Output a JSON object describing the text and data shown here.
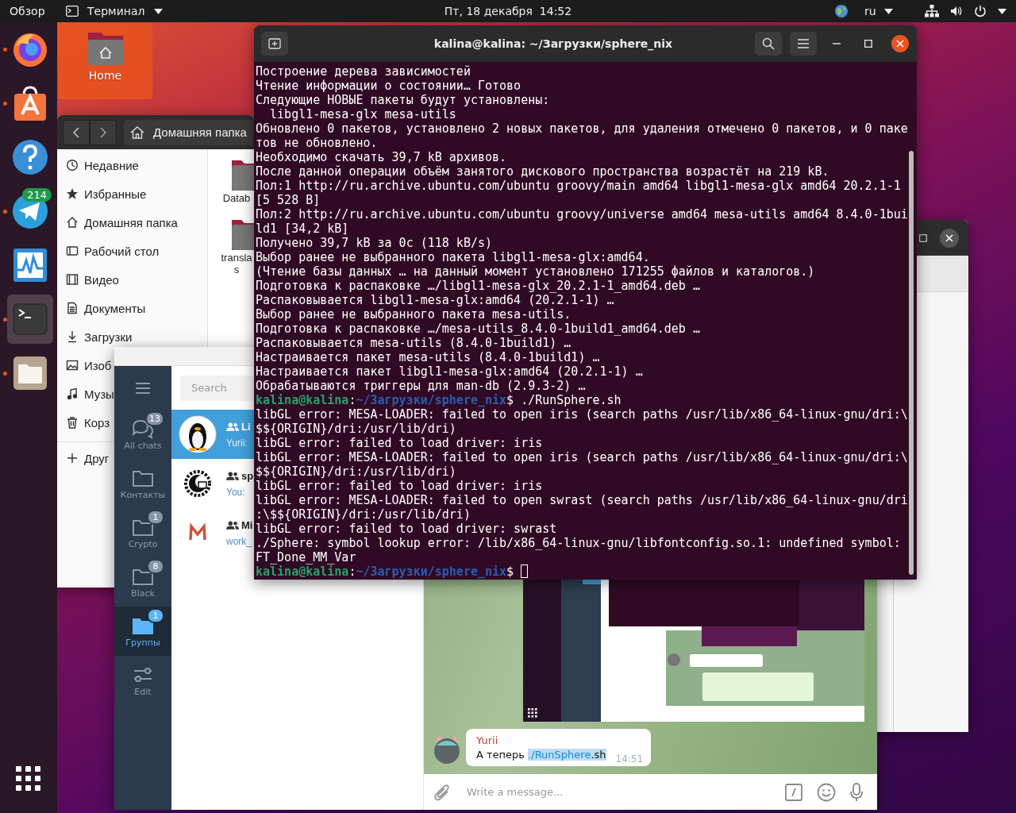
{
  "top_bar": {
    "activities": "Обзор",
    "app_menu": "Терминал",
    "clock": "Пт, 18 декабря  14:52",
    "keyboard_layout": "ru"
  },
  "dock": {
    "apps": [
      {
        "kind": "firefox",
        "running": true,
        "selected": false
      },
      {
        "kind": "software",
        "running": true,
        "selected": false
      },
      {
        "kind": "help",
        "running": false,
        "selected": false
      },
      {
        "kind": "telegram",
        "running": true,
        "selected": false,
        "badge": "214"
      },
      {
        "kind": "monitor",
        "running": false,
        "selected": false
      },
      {
        "kind": "terminal",
        "running": true,
        "selected": true
      },
      {
        "kind": "files",
        "running": true,
        "selected": false
      }
    ]
  },
  "desktop_icons": [
    {
      "label": "Home",
      "selected": true
    }
  ],
  "files_window": {
    "path": "Домашняя папка",
    "sidebar": [
      {
        "kind": "recent",
        "label": "Недавние"
      },
      {
        "kind": "starred",
        "label": "Избранные"
      },
      {
        "kind": "home",
        "label": "Домашняя папка"
      },
      {
        "kind": "desktop",
        "label": "Рабочий стол"
      },
      {
        "kind": "video",
        "label": "Видео"
      },
      {
        "kind": "documents",
        "label": "Документы"
      },
      {
        "kind": "downloads",
        "label": "Загрузки"
      },
      {
        "kind": "pictures",
        "label": "Изоб"
      },
      {
        "kind": "music",
        "label": "Музы"
      },
      {
        "kind": "trash",
        "label": "Корз"
      },
      {
        "kind": "other",
        "label": "Друг"
      }
    ],
    "folders": [
      {
        "lines": [
          "Datab"
        ]
      },
      {
        "lines": [
          "transla",
          "s"
        ]
      }
    ]
  },
  "terminal": {
    "title": "kalina@kalina: ~/Загрузки/sphere_nix",
    "lines": [
      {
        "kind": "output",
        "text": "Построение дерева зависимостей"
      },
      {
        "kind": "output",
        "text": "Чтение информации о состоянии… Готово"
      },
      {
        "kind": "output",
        "text": "Следующие НОВЫЕ пакеты будут установлены:"
      },
      {
        "kind": "output",
        "text": "  libgl1-mesa-glx mesa-utils"
      },
      {
        "kind": "output",
        "text": "Обновлено 0 пакетов, установлено 2 новых пакетов, для удаления отмечено 0 пакетов, и 0 паке"
      },
      {
        "kind": "output",
        "text": "тов не обновлено."
      },
      {
        "kind": "output",
        "text": "Необходимо скачать 39,7 kB архивов."
      },
      {
        "kind": "output",
        "text": "После данной операции объём занятого дискового пространства возрастёт на 219 kB."
      },
      {
        "kind": "output",
        "text": "Пол:1 http://ru.archive.ubuntu.com/ubuntu groovy/main amd64 libgl1-mesa-glx amd64 20.2.1-1"
      },
      {
        "kind": "output",
        "text": "[5 528 B]"
      },
      {
        "kind": "output",
        "text": "Пол:2 http://ru.archive.ubuntu.com/ubuntu groovy/universe amd64 mesa-utils amd64 8.4.0-1bui"
      },
      {
        "kind": "output",
        "text": "ld1 [34,2 kB]"
      },
      {
        "kind": "output",
        "text": "Получено 39,7 kB за 0с (118 kB/s)"
      },
      {
        "kind": "output",
        "text": "Выбор ранее не выбранного пакета libgl1-mesa-glx:amd64."
      },
      {
        "kind": "output",
        "text": "(Чтение базы данных … на данный момент установлено 171255 файлов и каталогов.)"
      },
      {
        "kind": "output",
        "text": "Подготовка к распаковке …/libgl1-mesa-glx_20.2.1-1_amd64.deb …"
      },
      {
        "kind": "output",
        "text": "Распаковывается libgl1-mesa-glx:amd64 (20.2.1-1) …"
      },
      {
        "kind": "output",
        "text": "Выбор ранее не выбранного пакета mesa-utils."
      },
      {
        "kind": "output",
        "text": "Подготовка к распаковке …/mesa-utils_8.4.0-1build1_amd64.deb …"
      },
      {
        "kind": "output",
        "text": "Распаковывается mesa-utils (8.4.0-1build1) …"
      },
      {
        "kind": "output",
        "text": "Настраивается пакет mesa-utils (8.4.0-1build1) …"
      },
      {
        "kind": "output",
        "text": "Настраивается пакет libgl1-mesa-glx:amd64 (20.2.1-1) …"
      },
      {
        "kind": "output",
        "text": "Обрабатываются триггеры для man-db (2.9.3-2) …"
      },
      {
        "kind": "prompt",
        "user": "kalina@kalina",
        "sep": ":",
        "path": "~/Загрузки/sphere_nix",
        "sigil": "$",
        "command": " ./RunSphere.sh",
        "cursor": false
      },
      {
        "kind": "output",
        "text": "libGL error: MESA-LOADER: failed to open iris (search paths /usr/lib/x86_64-linux-gnu/dri:\\"
      },
      {
        "kind": "output",
        "text": "$${ORIGIN}/dri:/usr/lib/dri)"
      },
      {
        "kind": "output",
        "text": "libGL error: failed to load driver: iris"
      },
      {
        "kind": "output",
        "text": "libGL error: MESA-LOADER: failed to open iris (search paths /usr/lib/x86_64-linux-gnu/dri:\\"
      },
      {
        "kind": "output",
        "text": "$${ORIGIN}/dri:/usr/lib/dri)"
      },
      {
        "kind": "output",
        "text": "libGL error: failed to load driver: iris"
      },
      {
        "kind": "output",
        "text": "libGL error: MESA-LOADER: failed to open swrast (search paths /usr/lib/x86_64-linux-gnu/dri"
      },
      {
        "kind": "output",
        "text": ":\\$${ORIGIN}/dri:/usr/lib/dri)"
      },
      {
        "kind": "output",
        "text": "libGL error: failed to load driver: swrast"
      },
      {
        "kind": "output",
        "text": "./Sphere: symbol lookup error: /lib/x86_64-linux-gnu/libfontconfig.so.1: undefined symbol:"
      },
      {
        "kind": "output",
        "text": "FT_Done_MM_Var"
      },
      {
        "kind": "prompt",
        "user": "kalina@kalina",
        "sep": ":",
        "path": "~/Загрузки/sphere_nix",
        "sigil": "$",
        "cursor": true
      }
    ]
  },
  "telegram": {
    "search": {
      "placeholder": "Search"
    },
    "folders": [
      {
        "kind": "chats",
        "label": "All chats",
        "badge": "13",
        "selected": false
      },
      {
        "kind": "folder",
        "label": "Контакты",
        "selected": false
      },
      {
        "kind": "folder",
        "label": "Crypto",
        "badge": "1",
        "selected": false
      },
      {
        "kind": "folder",
        "label": "Black",
        "badge": "8",
        "selected": false
      },
      {
        "kind": "folder",
        "label": "Группы",
        "badge": "1",
        "selected": true
      },
      {
        "kind": "edit",
        "label": "Edit",
        "selected": false
      }
    ],
    "chats": [
      {
        "kind": "penguin",
        "title": "Li",
        "preview": "Yurii:",
        "selected": true
      },
      {
        "kind": "sun",
        "title": "sp",
        "preview": "You:",
        "selected": false
      },
      {
        "kind": "letter_m",
        "title": "Mi",
        "preview": "work_",
        "selected": false
      }
    ],
    "messages": [
      {
        "kind": "picture"
      },
      {
        "kind": "text",
        "author": "Yurii",
        "text": "А теперь",
        "link": "./RunSphere",
        "rest": ".sh",
        "time": "14:51",
        "highlighted": true
      }
    ],
    "composer": {
      "placeholder": "Write a message..."
    }
  }
}
